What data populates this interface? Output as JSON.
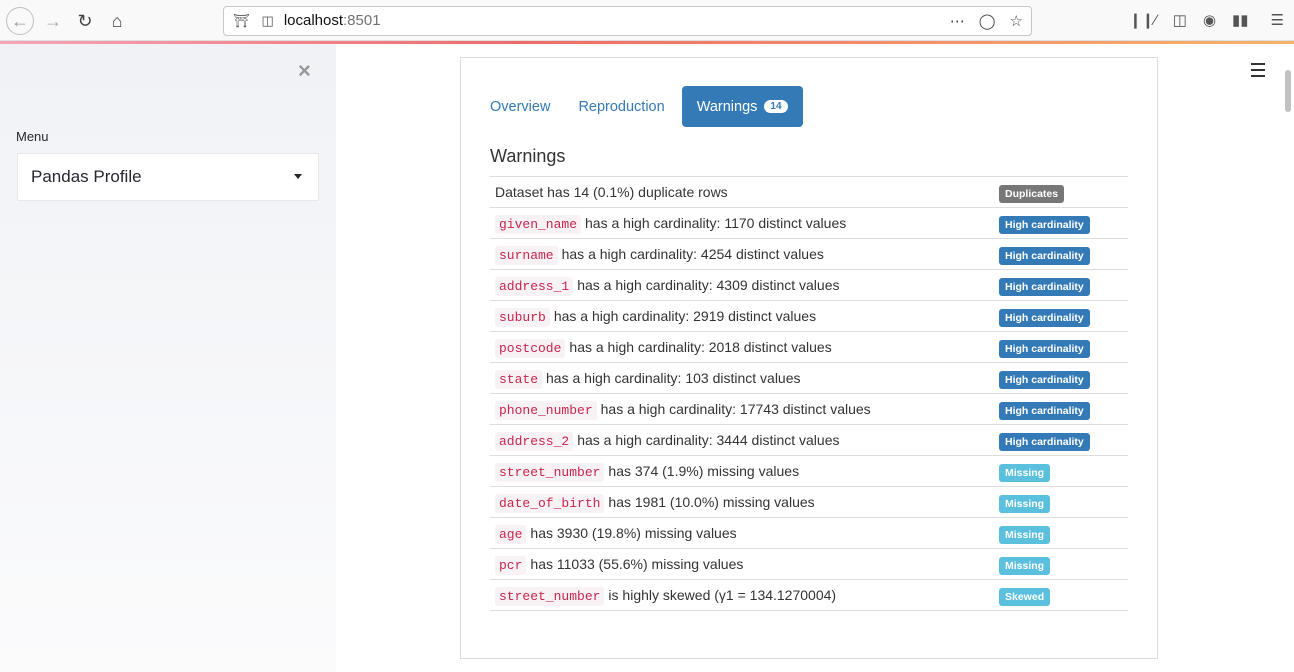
{
  "browser": {
    "url_host": "localhost",
    "url_port": ":8501"
  },
  "sidebar": {
    "menu_label": "Menu",
    "selected": "Pandas Profile"
  },
  "tabs": [
    {
      "label": "Overview"
    },
    {
      "label": "Reproduction"
    },
    {
      "label": "Warnings",
      "badge": "14"
    }
  ],
  "heading": "Warnings",
  "colors": {
    "Duplicates": "#777777",
    "High cardinality": "#337ab7",
    "Missing": "#5bc0de",
    "Skewed": "#5bc0de"
  },
  "warnings": [
    {
      "code": "",
      "text": "Dataset has 14 (0.1%) duplicate rows",
      "badge": "Duplicates"
    },
    {
      "code": "given_name",
      "text": "has a high cardinality: 1170 distinct values",
      "badge": "High cardinality"
    },
    {
      "code": "surname",
      "text": "has a high cardinality: 4254 distinct values",
      "badge": "High cardinality"
    },
    {
      "code": "address_1",
      "text": "has a high cardinality: 4309 distinct values",
      "badge": "High cardinality"
    },
    {
      "code": "suburb",
      "text": "has a high cardinality: 2919 distinct values",
      "badge": "High cardinality"
    },
    {
      "code": "postcode",
      "text": "has a high cardinality: 2018 distinct values",
      "badge": "High cardinality"
    },
    {
      "code": "state",
      "text": "has a high cardinality: 103 distinct values",
      "badge": "High cardinality"
    },
    {
      "code": "phone_number",
      "text": "has a high cardinality: 17743 distinct values",
      "badge": "High cardinality"
    },
    {
      "code": "address_2",
      "text": "has a high cardinality: 3444 distinct values",
      "badge": "High cardinality"
    },
    {
      "code": "street_number",
      "text": "has 374 (1.9%) missing values",
      "badge": "Missing"
    },
    {
      "code": "date_of_birth",
      "text": "has 1981 (10.0%) missing values",
      "badge": "Missing"
    },
    {
      "code": "age",
      "text": "has 3930 (19.8%) missing values",
      "badge": "Missing"
    },
    {
      "code": "pcr",
      "text": "has 11033 (55.6%) missing values",
      "badge": "Missing"
    },
    {
      "code": "street_number",
      "text": "is highly skewed (γ1 = 134.1270004)",
      "badge": "Skewed"
    }
  ]
}
